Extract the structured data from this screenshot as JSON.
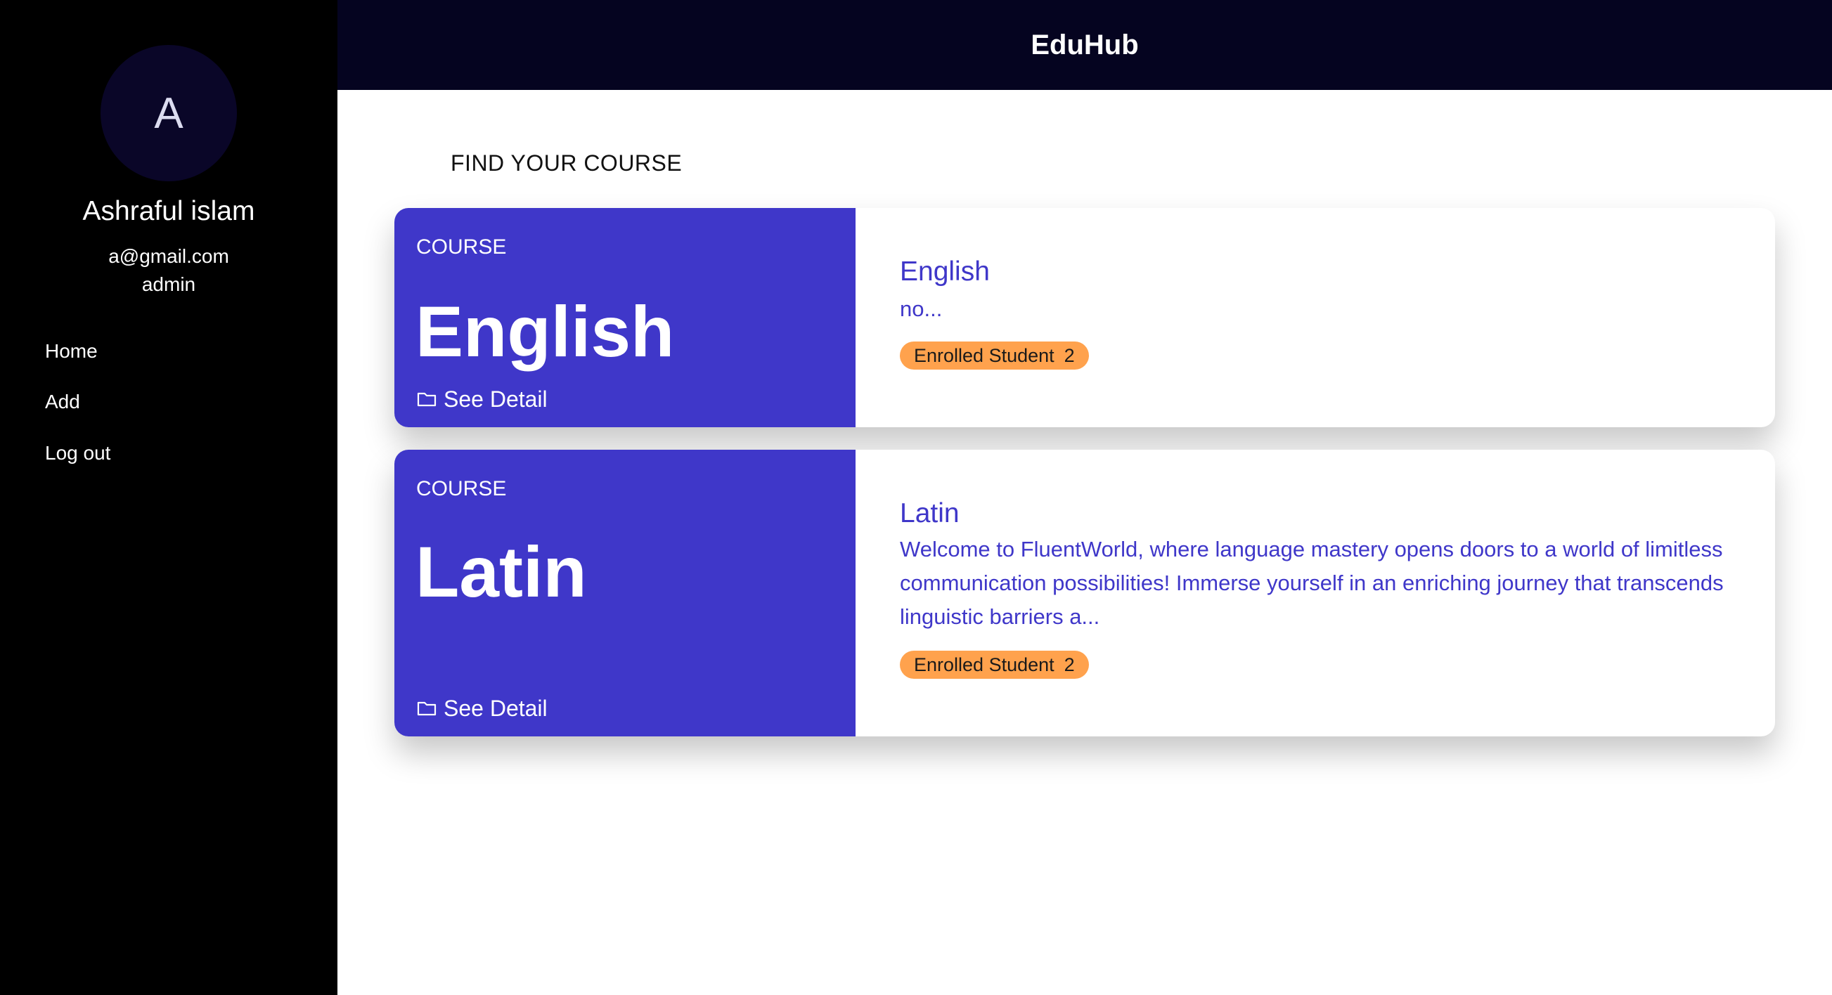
{
  "sidebar": {
    "avatar_letter": "A",
    "user_name": "Ashraful islam",
    "user_email": "a@gmail.com",
    "user_role": "admin",
    "nav": [
      "Home",
      "Add",
      "Log out"
    ]
  },
  "header": {
    "title": "EduHub"
  },
  "main": {
    "section_title": "FIND YOUR COURSE",
    "courses": [
      {
        "label": "COURSE",
        "name": "English",
        "title": "English",
        "description": "no...",
        "badge_label": "Enrolled Student",
        "badge_count": "2",
        "detail_label": "See Detail"
      },
      {
        "label": "COURSE",
        "name": "Latin",
        "title": "Latin",
        "description": "Welcome to FluentWorld, where language mastery opens doors to a world of limitless communication possibilities! Immerse yourself in an enriching journey that transcends linguistic barriers a...",
        "badge_label": "Enrolled Student",
        "badge_count": "2",
        "detail_label": "See Detail"
      }
    ]
  },
  "colors": {
    "accent": "#3f37c9",
    "badge": "#ffa24d",
    "header_bg": "#050420",
    "sidebar_bg": "#000000"
  },
  "icons": {
    "detail": "folder-icon"
  }
}
